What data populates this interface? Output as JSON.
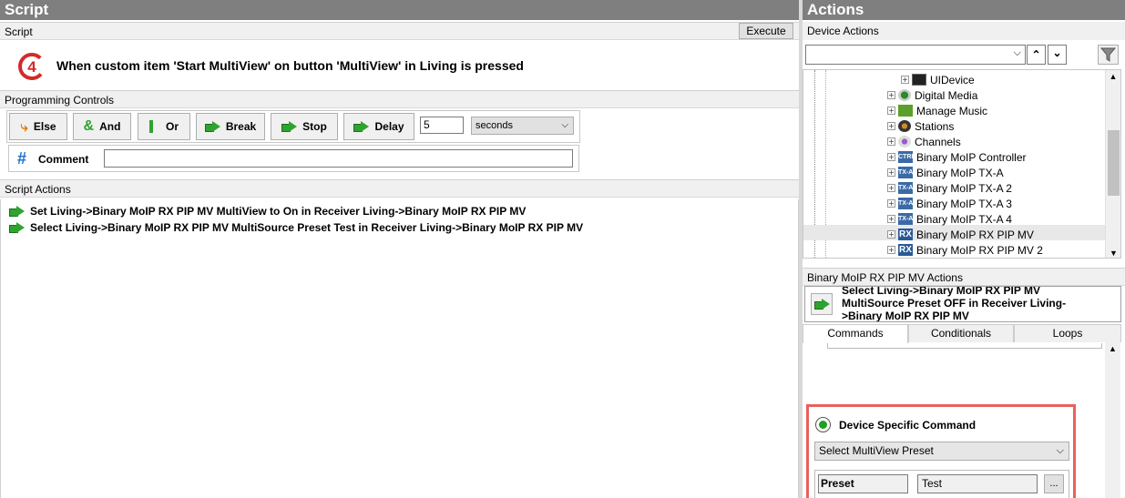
{
  "script_panel": {
    "title": "Script",
    "section": "Script",
    "execute_label": "Execute",
    "trigger_text": "When custom item 'Start MultiView' on button 'MultiView' in Living is pressed",
    "logo_glyph": "4"
  },
  "programming": {
    "title": "Programming Controls",
    "else": "Else",
    "and": "And",
    "or": "Or",
    "break": "Break",
    "stop": "Stop",
    "delay": "Delay",
    "delay_value": "5",
    "delay_unit": "seconds",
    "comment": "Comment",
    "comment_value": ""
  },
  "script_actions": {
    "title": "Script Actions",
    "items": [
      "Set Living->Binary MoIP RX PIP MV MultiView to  On in Receiver Living->Binary MoIP RX PIP MV",
      "Select Living->Binary MoIP RX PIP MV MultiSource Preset Test in Receiver Living->Binary MoIP RX PIP MV"
    ]
  },
  "actions_panel": {
    "title": "Actions",
    "device_actions": "Device Actions",
    "search_value": ""
  },
  "tree": [
    {
      "label": "UIDevice",
      "icon": "uidevice-icon",
      "level": 2
    },
    {
      "label": "Digital Media",
      "icon": "digital-media-icon",
      "level": 1
    },
    {
      "label": "Manage Music",
      "icon": "music-icon",
      "level": 1
    },
    {
      "label": "Stations",
      "icon": "stations-icon",
      "level": 1
    },
    {
      "label": "Channels",
      "icon": "channels-icon",
      "level": 1
    },
    {
      "label": "Binary MoIP Controller",
      "icon": "ctrl-icon",
      "level": 1,
      "badge": "CTRL"
    },
    {
      "label": "Binary MoIP TX-A",
      "icon": "tx-icon",
      "level": 1,
      "badge": "TX-A"
    },
    {
      "label": "Binary MoIP TX-A 2",
      "icon": "tx-icon",
      "level": 1,
      "badge": "TX-A"
    },
    {
      "label": "Binary MoIP TX-A 3",
      "icon": "tx-icon",
      "level": 1,
      "badge": "TX-A"
    },
    {
      "label": "Binary MoIP TX-A 4",
      "icon": "tx-icon",
      "level": 1,
      "badge": "TX-A"
    },
    {
      "label": "Binary MoIP RX PIP MV",
      "icon": "rx-icon",
      "level": 1,
      "badge": "RX",
      "selected": true
    },
    {
      "label": "Binary MoIP RX PIP MV 2",
      "icon": "rx-icon",
      "level": 1,
      "badge": "RX"
    }
  ],
  "device_actions": {
    "title": "Binary MoIP RX PIP MV Actions",
    "current_action": "Select Living->Binary MoIP RX PIP MV MultiSource Preset  OFF in Receiver Living->Binary MoIP RX PIP MV"
  },
  "tabs": [
    "Commands",
    "Conditionals",
    "Loops"
  ],
  "command": {
    "label": "Device Specific Command",
    "select_value": "Select MultiView Preset",
    "param_name": "Preset",
    "param_value": "Test",
    "browse_label": "..."
  },
  "colors": {
    "header_gray": "#7f7f7f",
    "highlight_border": "#e8625a",
    "arrow_green": "#2fa32f",
    "logo_red": "#d32a2a"
  }
}
